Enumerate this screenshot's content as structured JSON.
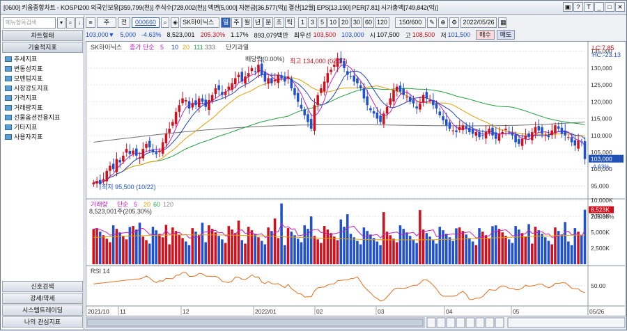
{
  "window": {
    "title": "[0600] 키움종합차트 - KOSPI200 외국인보유[359,799(천)] 주식수[728,002(천)] 액면[5,000] 자본금[36,577(억)] 결산[12월] EPS[13,190] PER[7.81] 시가총액[749,842(억)]",
    "buttons": [
      "▣",
      "?",
      "T",
      "_",
      "□",
      "✕"
    ]
  },
  "left_panel": {
    "search_placeholder": "메뉴항목검색",
    "search_buttons": [
      "▾",
      "🔍",
      "↓"
    ],
    "chart_type_label": "차트형태",
    "indicators_label": "기술적지표",
    "items": [
      "추세지표",
      "변동성지표",
      "모멘텀지표",
      "시장강도지표",
      "가격지표",
      "거래량지표",
      "선물옵션전용지표",
      "기타지표",
      "사용자지표"
    ],
    "bottom": [
      "신호검색",
      "강세/약세",
      "시스템트레이딩",
      "나의 관심지표"
    ]
  },
  "toolbar1": {
    "menu_icon": "≡",
    "market": "주",
    "all": "전",
    "code": "000660",
    "stock_name": "SK하이닉스",
    "tabs": [
      "일",
      "주",
      "월",
      "년",
      "분",
      "초",
      "틱"
    ],
    "active_tab": "일",
    "periods": [
      "1",
      "3",
      "5",
      "10",
      "20",
      "30",
      "60",
      "120"
    ],
    "count": "150/600",
    "date": "2022/05/26"
  },
  "toolbar2": {
    "price": "103,000▼",
    "change": "5,000",
    "change_pct": "-4.63%",
    "volume": "8,523,001",
    "volume_pct": "205.30%",
    "turnover": "1.17%",
    "amount": "893,079백만",
    "low_label": "최우선",
    "bid": "103,500",
    "ask": "103,000",
    "open_label": "시",
    "open": "107,500",
    "high_label": "고",
    "high": "108,500",
    "lowp_label": "저",
    "lowp": "101,500",
    "buy": "매수",
    "sell": "매도"
  },
  "price_panel": {
    "legend_name": "SK하이닉스",
    "legend_ma": "종가 단순",
    "ma_periods": [
      "5",
      "10",
      "20",
      "111",
      "333"
    ],
    "legend_extra": "단기과열",
    "lc": "LC:7.85",
    "hc": "HC:-23.13",
    "y_ticks": [
      "135,000",
      "130,000",
      "125,000",
      "120,000",
      "115,000",
      "110,000",
      "105,000",
      "100,000",
      "95,000"
    ],
    "current_price": "103,000",
    "current_change": "-4.63%",
    "annotation_high": "최고 134,000 (02/17)",
    "annotation_low": "최저 95,500 (10/22)",
    "annotation_div": "배당락(0.00%)"
  },
  "volume_panel": {
    "legend": "거래량",
    "ma_label": "단순",
    "ma_periods": [
      "5",
      "20",
      "60",
      "120"
    ],
    "value_label": "8,523,001주(205.30%)",
    "y_ticks": [
      "10,000K",
      "7,500K",
      "5,000K",
      "2,500K"
    ],
    "current": "8,523K",
    "current_pct": "205.30%"
  },
  "rsi_panel": {
    "legend": "RSI 14",
    "y_tick": "50.00"
  },
  "x_axis": {
    "labels": [
      "2021/10",
      "11",
      "12",
      "2022/01",
      "02",
      "03",
      "04",
      "05",
      "05/26"
    ]
  },
  "colors": {
    "up": "#d0101c",
    "down": "#1e50d0",
    "ma5": "#c020c0",
    "ma10": "#2040c0",
    "ma20": "#e0a000",
    "ma111": "#20a040",
    "ma333": "#707070"
  },
  "chart_data": {
    "type": "candlestick",
    "x_start": "2021/10/06",
    "x_end": "2022/05/26",
    "price_range": [
      92000,
      137000
    ],
    "closes": [
      96000,
      96500,
      95500,
      97000,
      99500,
      101000,
      100000,
      103000,
      102000,
      104000,
      106000,
      104500,
      105500,
      104000,
      103500,
      106000,
      107500,
      106500,
      105000,
      104500,
      105500,
      108000,
      110500,
      112000,
      114000,
      117000,
      119000,
      121000,
      120500,
      118000,
      119500,
      119000,
      121000,
      120000,
      118500,
      120500,
      122000,
      124000,
      123500,
      122000,
      123000,
      124500,
      125500,
      127000,
      128000,
      126000,
      127500,
      128500,
      130000,
      129000,
      131000,
      128000,
      126000,
      127000,
      125500,
      126500,
      128000,
      127000,
      126000,
      127500,
      124000,
      122000,
      120000,
      118000,
      116000,
      114000,
      112000,
      119000,
      122000,
      124000,
      126000,
      128500,
      129500,
      131000,
      133000,
      131500,
      130000,
      128000,
      127500,
      126000,
      125500,
      124000,
      121000,
      119000,
      117500,
      116500,
      115000,
      114000,
      116500,
      118500,
      121000,
      123500,
      124500,
      123000,
      122000,
      121500,
      120000,
      119500,
      118000,
      119500,
      122000,
      121000,
      120500,
      119000,
      118000,
      116000,
      114500,
      113000,
      112000,
      111500,
      111000,
      112500,
      113000,
      112000,
      111000,
      110500,
      111000,
      109500,
      110000,
      111000,
      112000,
      110000,
      109000,
      110500,
      111000,
      112000,
      111000,
      110000,
      108000,
      107500,
      109000,
      110000,
      109500,
      111000,
      112500,
      111500,
      110500,
      110000,
      109500,
      111500,
      113000,
      112000,
      110500,
      110000,
      109500,
      108000,
      107000,
      108500,
      108000,
      103000
    ],
    "annotations": {
      "high": {
        "value": 134000,
        "date": "02/17"
      },
      "low": {
        "value": 95500,
        "date": "10/22"
      }
    },
    "volume_max": 10000,
    "rsi_last": 32
  }
}
